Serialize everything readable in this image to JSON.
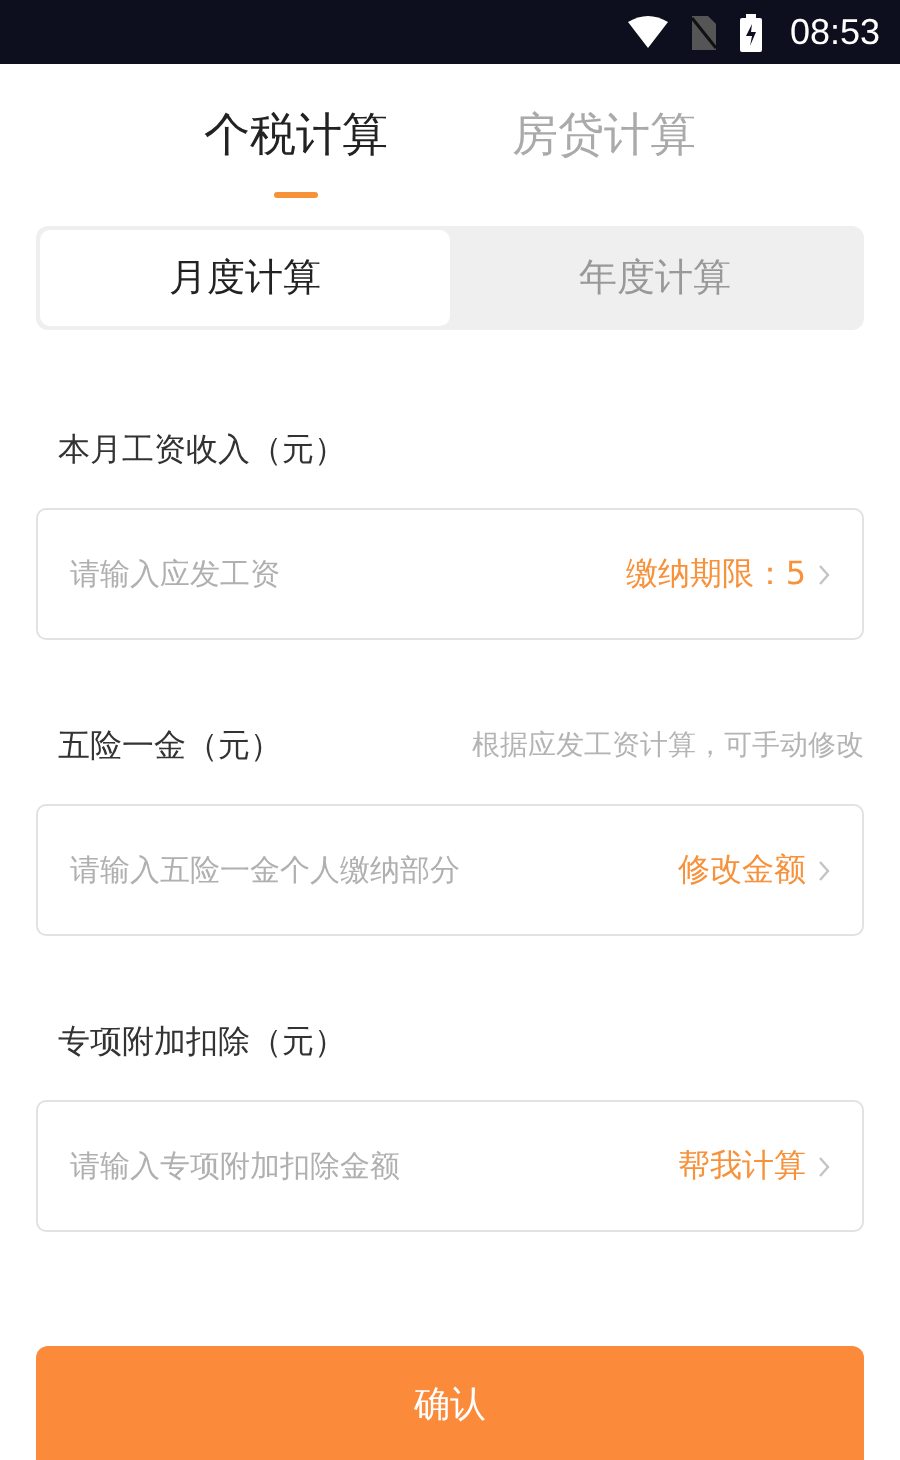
{
  "status_bar": {
    "time": "08:53"
  },
  "tabs": [
    {
      "label": "个税计算",
      "selected": true
    },
    {
      "label": "房贷计算",
      "selected": false
    }
  ],
  "segments": [
    {
      "label": "月度计算",
      "selected": true
    },
    {
      "label": "年度计算",
      "selected": false
    }
  ],
  "fields": [
    {
      "label": "本月工资收入（元）",
      "placeholder": "请输入应发工资",
      "action": "缴纳期限：5"
    },
    {
      "label": "五险一金（元）",
      "hint": "根据应发工资计算，可手动修改",
      "placeholder": "请输入五险一金个人缴纳部分",
      "action": "修改金额"
    },
    {
      "label": "专项附加扣除（元）",
      "placeholder": "请输入专项附加扣除金额",
      "action": "帮我计算"
    }
  ],
  "confirm_button": "确认"
}
